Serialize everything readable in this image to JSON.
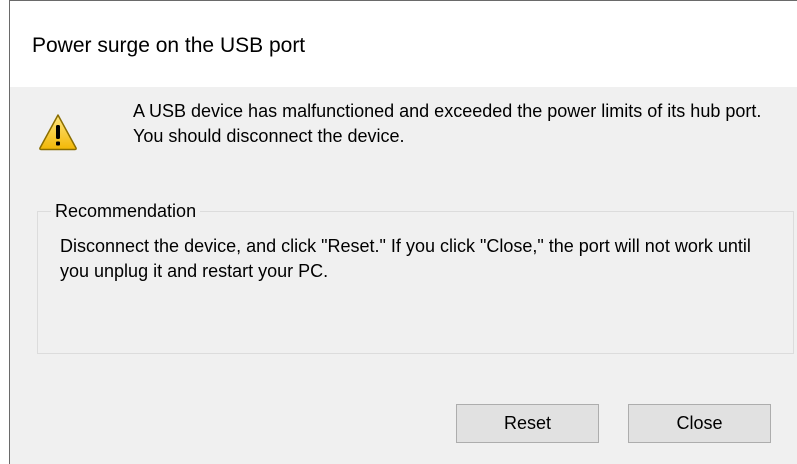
{
  "dialog": {
    "title": "Power surge on the USB port",
    "icon": "warning-icon",
    "message": "A USB device has malfunctioned and exceeded the power limits of its hub port. You should disconnect the device.",
    "recommendation": {
      "legend": "Recommendation",
      "text": "Disconnect the device, and click \"Reset.\" If you click \"Close,\" the port will not work until you unplug it and restart your PC."
    },
    "buttons": {
      "reset_label": "Reset",
      "close_label": "Close"
    },
    "colors": {
      "background": "#f0f0f0",
      "title_background": "#ffffff",
      "warning_fill": "#fcd116",
      "warning_outline": "#8a6d00",
      "button_face": "#e1e1e1",
      "button_border": "#adadad"
    }
  }
}
